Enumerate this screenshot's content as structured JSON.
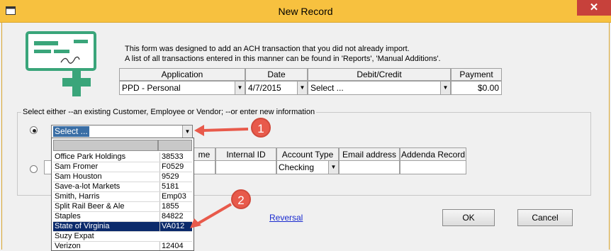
{
  "window": {
    "title": "New Record",
    "close_glyph": "✕"
  },
  "description": {
    "line1": "This form was designed to add an ACH transaction that you did not already import.",
    "line2": "A list of all transactions entered in this manner can be found in 'Reports', 'Manual Additions'."
  },
  "grid1": {
    "headers": {
      "application": "Application",
      "date": "Date",
      "debit_credit": "Debit/Credit",
      "payment": "Payment"
    },
    "application_value": "PPD - Personal",
    "date_value": "4/7/2015",
    "debit_credit_value": "Select ...",
    "payment_value": "$0.00"
  },
  "group": {
    "label": "Select either --an existing Customer, Employee or Vendor;  --or enter new information"
  },
  "combo": {
    "value": "Select ..."
  },
  "grid2": {
    "headers": {
      "name_tail": "me",
      "internal_id": "Internal ID",
      "account_type": "Account Type",
      "email": "Email address",
      "addenda": "Addenda Record"
    },
    "account_type_value": "Checking"
  },
  "dropdown": {
    "rows": [
      {
        "name": "Office Park Holdings",
        "code": "38533"
      },
      {
        "name": "Sam Fromer",
        "code": "F0529"
      },
      {
        "name": "Sam Houston",
        "code": "9529"
      },
      {
        "name": "Save-a-lot Markets",
        "code": "5181"
      },
      {
        "name": "Smith, Harris",
        "code": "Emp03"
      },
      {
        "name": "Split Rail Beer & Ale",
        "code": "1855"
      },
      {
        "name": "Staples",
        "code": "84822"
      },
      {
        "name": "State of Virginia",
        "code": "VA012"
      },
      {
        "name": "Suzy Expat",
        "code": ""
      },
      {
        "name": "Verizon",
        "code": "12404"
      }
    ],
    "selected_index": 7
  },
  "reversal_link": "Reversal",
  "buttons": {
    "ok": "OK",
    "cancel": "Cancel"
  },
  "annotations": {
    "badge1": "1",
    "badge2": "2"
  },
  "colors": {
    "titlebar": "#f7c13f",
    "close": "#c7413b",
    "selection": "#0b2a6b",
    "annotation": "#e85a4b",
    "check_icon": "#3aa57a"
  }
}
